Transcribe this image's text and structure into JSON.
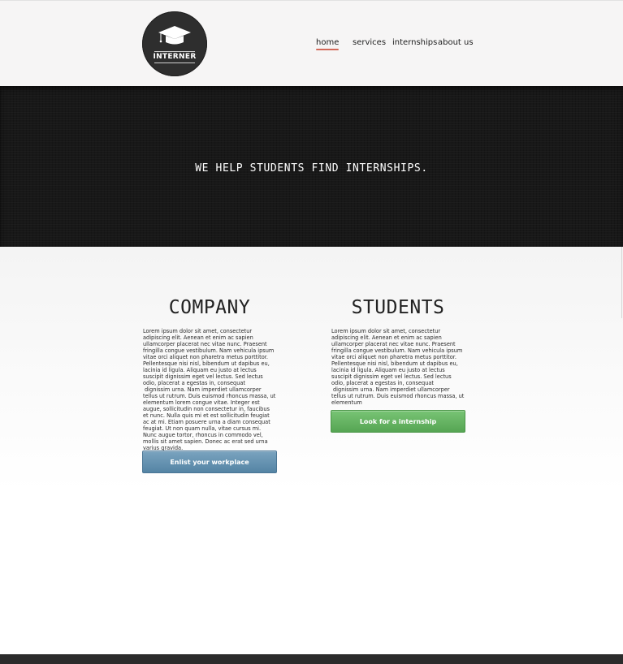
{
  "brand": {
    "logo_text": "INTERNER",
    "logo_icon": "graduation-cap-icon"
  },
  "nav": {
    "items": [
      {
        "label": "home",
        "active": true
      },
      {
        "label": "services",
        "active": false
      },
      {
        "label": "internships",
        "active": false
      },
      {
        "label": "about us",
        "active": false
      }
    ]
  },
  "hero": {
    "tagline": "WE HELP STUDENTS FIND INTERNSHIPS."
  },
  "company": {
    "title": "COMPANY",
    "paragraph_1": "Lorem ipsum dolor sit amet, consectetur adipiscing elit. Aenean et enim ac sapien ullamcorper placerat nec vitae nunc. Praesent fringilla congue vestibulum. Nam vehicula ipsum vitae orci aliquet non pharetra metus porttitor. Pellentesque nisi nisl, bibendum ut dapibus eu, lacinia id ligula. Aliquam eu justo at lectus suscipit dignissim eget vel lectus. Sed lectus odio, placerat a egestas in, consequat",
    "paragraph_2": "dignissim urna. Nam imperdiet ullamcorper tellus ut rutrum. Duis euismod rhoncus massa, ut elementum lorem congue vitae. Integer est augue, sollicitudin non consectetur in, faucibus et nunc. Nulla quis mi et est sollicitudin feugiat ac at mi. Etiam posuere urna a diam consequat feugiat. Ut non quam nulla, vitae cursus mi. Nunc augue tortor, rhoncus in commodo vel, mollis sit amet sapien. Donec ac erat sed urna varius gravida.",
    "button_label": "Enlist your workplace"
  },
  "students": {
    "title": "STUDENTS",
    "paragraph_1": "Lorem ipsum dolor sit amet, consectetur adipiscing elit. Aenean et enim ac sapien ullamcorper placerat nec vitae nunc. Praesent fringilla congue vestibulum. Nam vehicula ipsum vitae orci aliquet non pharetra metus porttitor. Pellentesque nisi nisl, bibendum ut dapibus eu, lacinia id ligula. Aliquam eu justo at lectus suscipit dignissim eget vel lectus. Sed lectus odio, placerat a egestas in, consequat",
    "paragraph_2": "dignissim urna. Nam imperdiet ullamcorper tellus ut rutrum. Duis euismod rhoncus massa, ut elementum",
    "button_label": "Look for a internship"
  },
  "colors": {
    "nav_active_underline": "#d2695a",
    "company_button": "#5e8cab",
    "students_button": "#62b060",
    "hero_background": "#181818"
  }
}
